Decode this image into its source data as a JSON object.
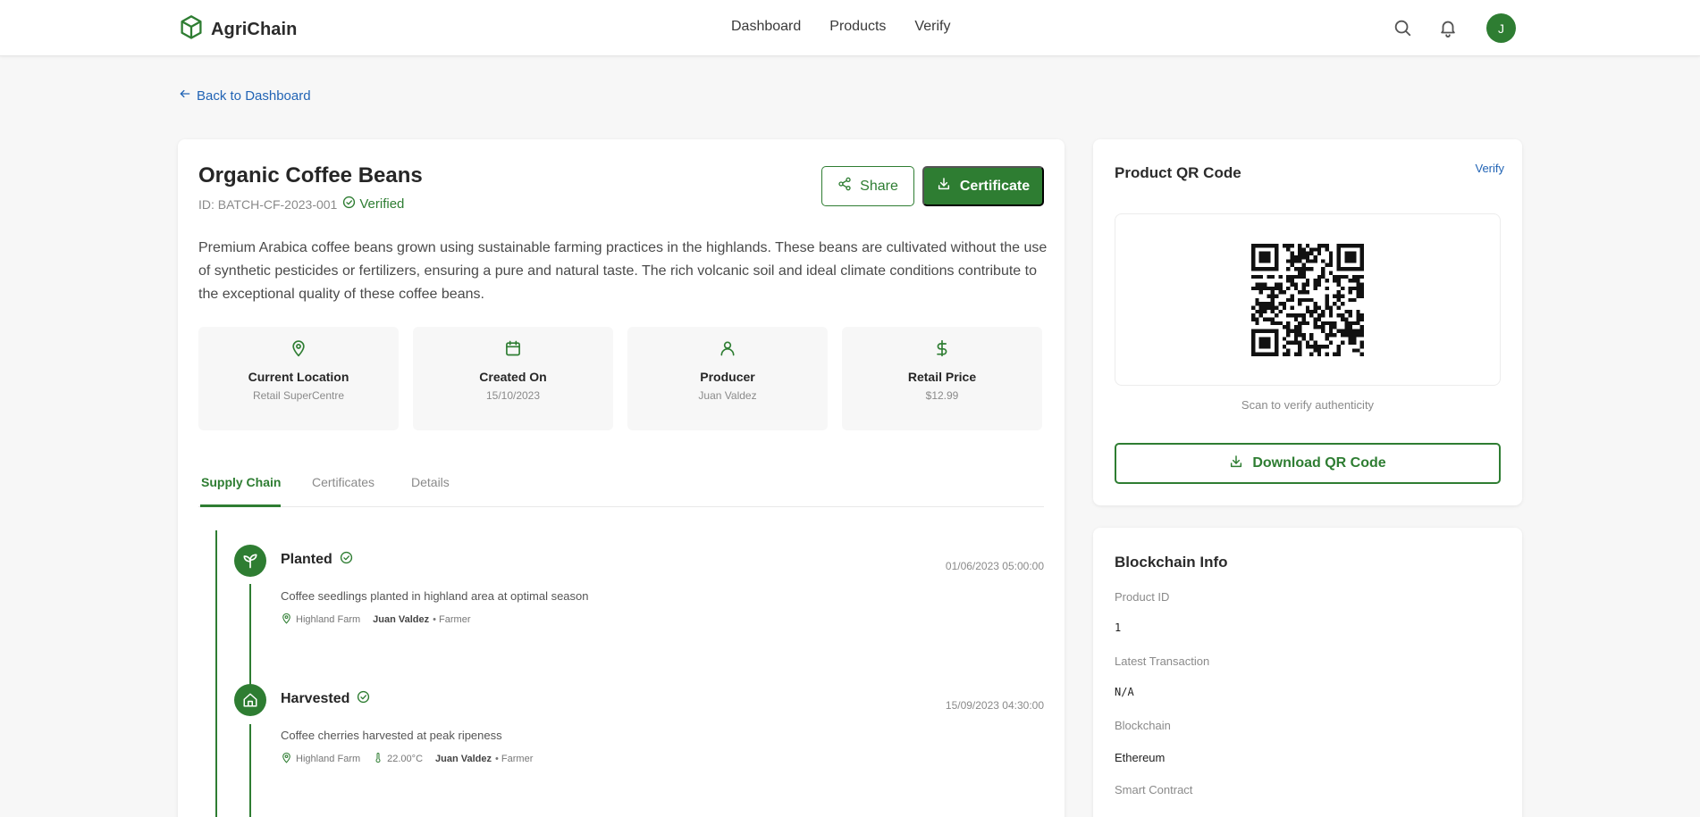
{
  "header": {
    "app_name": "AgriChain",
    "nav": [
      "Dashboard",
      "Products",
      "Verify"
    ],
    "avatar_initial": "J",
    "icons": [
      "search-icon",
      "bell-icon"
    ]
  },
  "back_link": "Back to Dashboard",
  "product": {
    "name": "Organic Coffee Beans",
    "batch_id": "ID: BATCH-CF-2023-001",
    "status": "Verified",
    "share_label": "Share",
    "certificate_label": "Certificate",
    "description": "Premium Arabica coffee beans grown using sustainable farming practices in the highlands. These beans are cultivated without the use of synthetic pesticides or fertilizers, ensuring a pure and natural taste. The rich volcanic soil and ideal climate conditions contribute to the exceptional quality of these coffee beans.",
    "stats": [
      {
        "label": "Current Location",
        "value": "Retail SuperCentre",
        "icon": "map-pin-icon"
      },
      {
        "label": "Created On",
        "value": "15/10/2023",
        "icon": "calendar-icon"
      },
      {
        "label": "Producer",
        "value": "Juan Valdez",
        "icon": "user-icon"
      },
      {
        "label": "Retail Price",
        "value": "$12.99",
        "icon": "dollar-icon"
      }
    ]
  },
  "tabs": [
    "Supply Chain",
    "Certificates",
    "Details"
  ],
  "active_tab": "Supply Chain",
  "timeline": [
    {
      "title": "Planted",
      "timestamp": "01/06/2023 05:00:00",
      "description": "Coffee seedlings planted in highland area at optimal season",
      "location": "Highland Farm",
      "actor": "Juan Valdez",
      "role": "• Farmer",
      "icon": "sprout-icon"
    },
    {
      "title": "Harvested",
      "timestamp": "15/09/2023 04:30:00",
      "description": "Coffee cherries harvested at peak ripeness",
      "location": "Highland Farm",
      "temperature": "22.00°C",
      "actor": "Juan Valdez",
      "role": "• Farmer",
      "icon": "home-icon"
    }
  ],
  "qr": {
    "title": "Product QR Code",
    "verify_link": "Verify",
    "caption": "Scan to verify authenticity",
    "download_label": "Download QR Code"
  },
  "blockchain": {
    "title": "Blockchain Info",
    "fields": [
      {
        "label": "Product ID",
        "value": "1"
      },
      {
        "label": "Latest Transaction",
        "value": "N/A"
      },
      {
        "label": "Blockchain",
        "value": "Ethereum"
      },
      {
        "label": "Smart Contract",
        "value": ""
      }
    ]
  },
  "colors": {
    "primary": "#2e7d32",
    "link": "#2264b5",
    "background": "#f7f7f7"
  }
}
